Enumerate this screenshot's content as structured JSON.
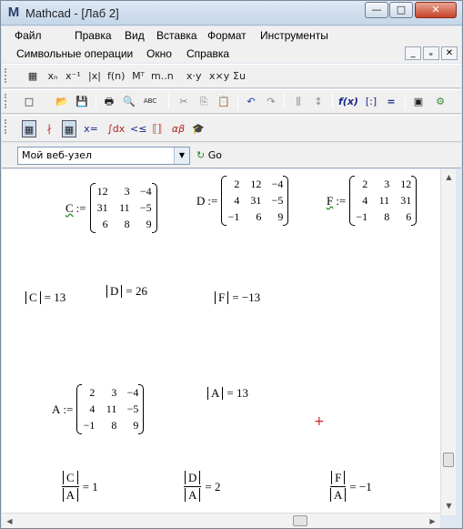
{
  "window": {
    "logo": "M",
    "title": "Mathcad - [Лаб 2]",
    "min": "—",
    "max": "□",
    "close": "✕"
  },
  "menu": {
    "row1": [
      "Файл",
      "Правка",
      "Вид",
      "Вставка",
      "Формат",
      "Инструменты"
    ],
    "row2": [
      "Символьные операции",
      "Окно",
      "Справка"
    ],
    "doc_controls": [
      "_",
      "ₑ",
      "✕"
    ]
  },
  "symbolic_toolbar": [
    "xₙ",
    "x⁻¹",
    "|x|",
    "f(n)",
    "Mᵀ",
    "m..n",
    "x·y",
    "x×y",
    "Σu",
    "▦"
  ],
  "standard_toolbar": [
    "□",
    "📂",
    "💾",
    "🖶",
    "🔍",
    "ABC",
    "✂",
    "⎘",
    "📋",
    "↶",
    "↷",
    "⫼",
    "↕",
    "f(x)",
    "[:]",
    "=",
    "▣",
    "⚙"
  ],
  "math_toolbar": [
    "▦",
    "∤",
    "▦",
    "x=",
    "∫dx",
    "<≤",
    "⟦⟧",
    "αβ",
    "🎓"
  ],
  "url": {
    "value": "Мой веб-узел",
    "go": "Go"
  },
  "matrices": {
    "C": {
      "label": "C",
      "op": ":=",
      "rows": [
        [
          "12",
          "3",
          "−4"
        ],
        [
          "31",
          "11",
          "−5"
        ],
        [
          "6",
          "8",
          "9"
        ]
      ]
    },
    "D": {
      "label": "D",
      "op": ":=",
      "rows": [
        [
          "2",
          "12",
          "−4"
        ],
        [
          "4",
          "31",
          "−5"
        ],
        [
          "−1",
          "6",
          "9"
        ]
      ]
    },
    "F": {
      "label": "F",
      "op": ":=",
      "rows": [
        [
          "2",
          "3",
          "12"
        ],
        [
          "4",
          "11",
          "31"
        ],
        [
          "−1",
          "8",
          "6"
        ]
      ]
    },
    "A": {
      "label": "A",
      "op": ":=",
      "rows": [
        [
          "2",
          "3",
          "−4"
        ],
        [
          "4",
          "11",
          "−5"
        ],
        [
          "−1",
          "8",
          "9"
        ]
      ]
    }
  },
  "determinants": {
    "C": {
      "var": "C",
      "eq": "= 13"
    },
    "D": {
      "var": "D",
      "eq": "= 26"
    },
    "F": {
      "var": "F",
      "eq": "= −13"
    },
    "A": {
      "var": "A",
      "eq": "= 13"
    }
  },
  "ratios": [
    {
      "num": "C",
      "den": "A",
      "eq": "= 1"
    },
    {
      "num": "D",
      "den": "A",
      "eq": "= 2"
    },
    {
      "num": "F",
      "den": "A",
      "eq": "= −1"
    }
  ],
  "cursor": "+"
}
